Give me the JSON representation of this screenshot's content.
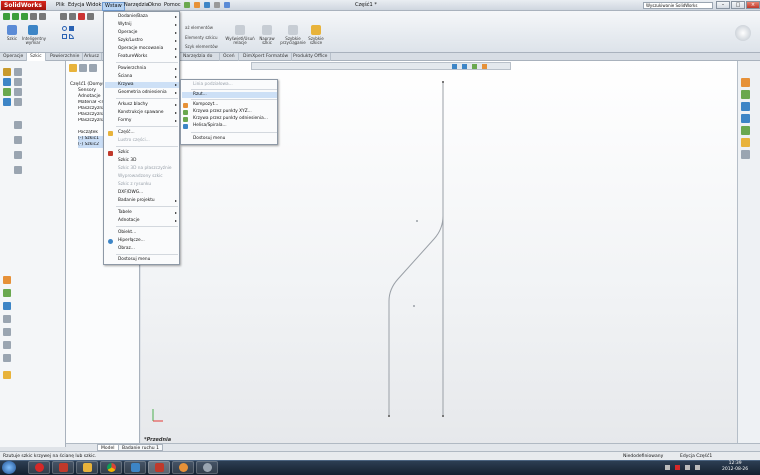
{
  "app": {
    "logo": "SolidWorks",
    "doc_title": "Część1 *",
    "search_placeholder": "Wyszukiwanie SolidWorks"
  },
  "menubar": [
    "Plik",
    "Edycja",
    "Widok",
    "Wstaw",
    "Narzędzia",
    "Okno",
    "Pomoc"
  ],
  "ribbon": {
    "buttons": [
      "Szkic",
      "Inteligentny wymiar",
      "Wydłuż/Skróć encje",
      "Szyk liniowy szkicu",
      "Wyświetl/Usuń relacje",
      "Napraw szkic",
      "Szybkie przyciąganie",
      "Szybkie szkice"
    ],
    "partial": [
      "aż elementów",
      "Elementy szkicu",
      "Szyk elementów"
    ]
  },
  "tabs": [
    "Operacje",
    "Szkic",
    "Powierzchnie",
    "Arkusz blachy",
    "Konstrukcje spawane",
    "Formy",
    "Narzędzia do form",
    "Oceń",
    "DimXpert Formatów",
    "Produkty Office"
  ],
  "tree": {
    "root": "Część1 (Domyślna)",
    "items": [
      "Sensory",
      "Adnotacje",
      "Materiał <nie określono>",
      "Płaszczyzna przednia",
      "Płaszczyzna górna",
      "Płaszczyzna prawa",
      "Początek",
      "(-) Szkic1",
      "(-) Szkic2"
    ]
  },
  "insert_menu": {
    "items": [
      "Dodanie/Baza",
      "Wytnij",
      "Operacje",
      "Szyk/Lustro",
      "Operacje mocowania",
      "FeatureWorks",
      "Powierzchnia",
      "Ściana",
      "Krzywa",
      "Geometria odniesienia",
      "Arkusz blachy",
      "Konstrukcje spawane",
      "Formy",
      "Część...",
      "Lustro części...",
      "Szkic",
      "Szkic 3D",
      "Szkic 3D na płaszczyźnie",
      "Wyprowadzony szkic",
      "Szkic z rysunku",
      "DXF/DWG...",
      "Badanie projektu",
      "Tabele",
      "Adnotacje",
      "Obiekt...",
      "Hiperłącze...",
      "Obraz...",
      "Dostosuj menu"
    ]
  },
  "curve_menu": {
    "items": [
      "Linia podziałowa...",
      "Rzut...",
      "Kompozyt...",
      "Krzywa przez punkty XYZ...",
      "Krzywa przez punkty odniesienia...",
      "Helisa/Spirala...",
      "Dostosuj menu"
    ]
  },
  "viewport": {
    "view_label": "*Przednia"
  },
  "bottom_tabs": [
    "Model",
    "Badanie ruchu 1"
  ],
  "status": {
    "left": "Rzutuje szkic krzywej na ścianę lub szkic.",
    "mid": "Niedodefiniowany",
    "right": "Edycja Część1"
  },
  "clock": {
    "time": "12:39",
    "date": "2012-08-26"
  },
  "colors": {
    "accent": "#cde0f6",
    "brand": "#c0392b"
  }
}
